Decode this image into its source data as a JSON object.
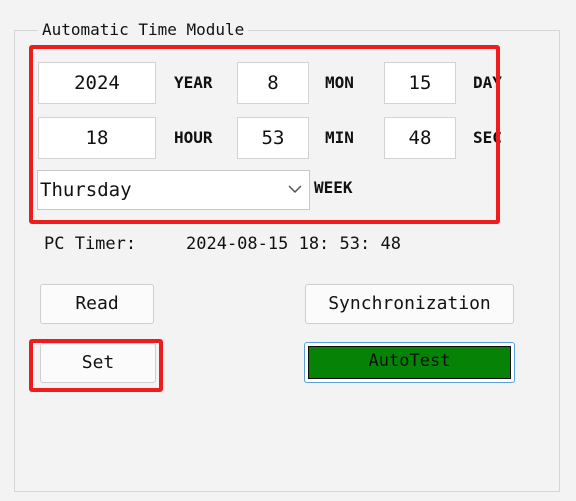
{
  "group": {
    "title": "Automatic Time Module"
  },
  "date": {
    "year": "2024",
    "year_label": "YEAR",
    "month": "8",
    "month_label": "MON",
    "day": "15",
    "day_label": "DAY"
  },
  "time": {
    "hour": "18",
    "hour_label": "HOUR",
    "minute": "53",
    "minute_label": "MIN",
    "second": "48",
    "second_label": "SEC"
  },
  "week": {
    "selected": "Thursday",
    "label": "WEEK"
  },
  "pc_timer": {
    "label": "PC Timer:",
    "value": "2024-08-15  18: 53: 48"
  },
  "buttons": {
    "read": "Read",
    "set": "Set",
    "synchronization": "Synchronization",
    "autotest": "AutoTest"
  },
  "colors": {
    "highlight_red": "#ee1c1c",
    "autotest_green": "#068306",
    "focus_blue": "#5aa0e0"
  }
}
